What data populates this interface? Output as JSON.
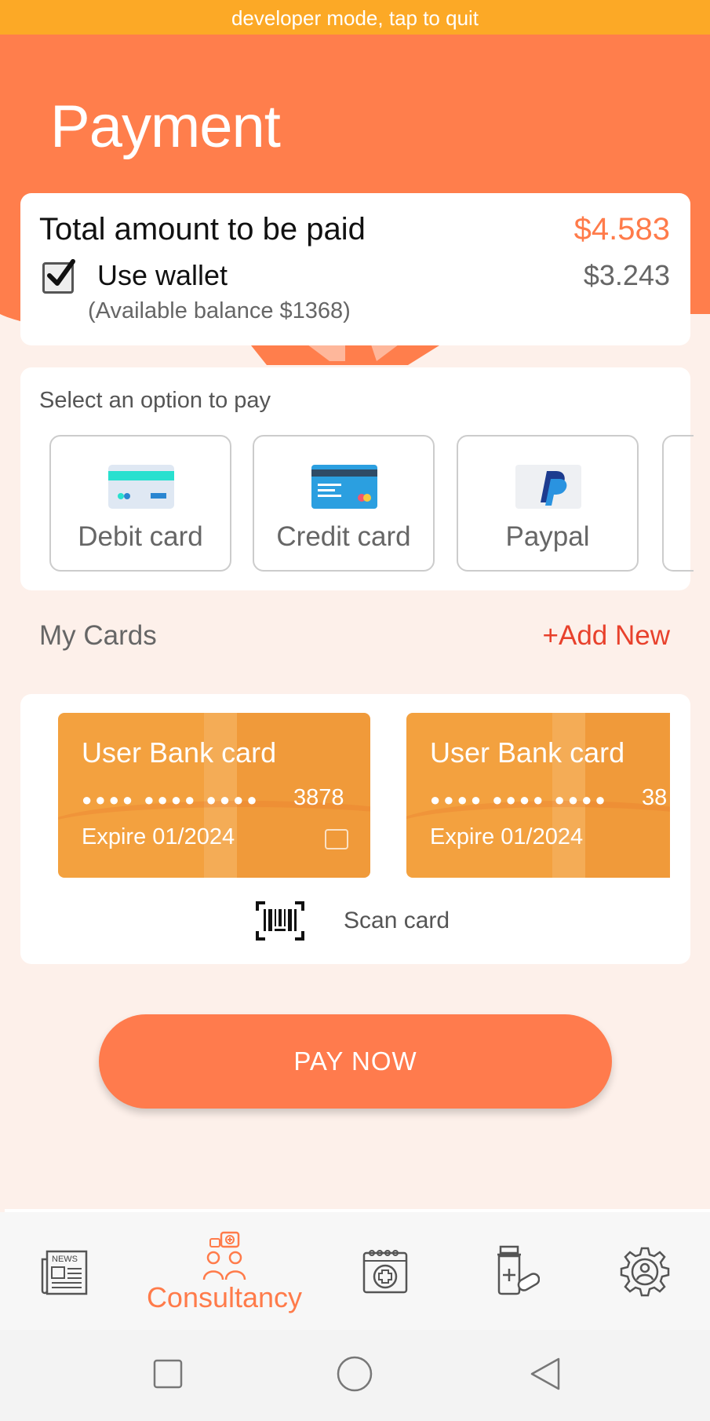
{
  "dev_banner": "developer mode, tap to quit",
  "page_title": "Payment",
  "summary": {
    "total_label": "Total amount to be paid",
    "total_value": "$4.583",
    "wallet_label": "Use wallet",
    "wallet_value": "$3.243",
    "wallet_checked": true,
    "available_balance": "(Available balance $1368)"
  },
  "payment_options": {
    "title": "Select an option to pay",
    "items": [
      {
        "label": "Debit card",
        "icon": "debit-card-icon"
      },
      {
        "label": "Credit card",
        "icon": "credit-card-icon"
      },
      {
        "label": "Paypal",
        "icon": "paypal-icon"
      }
    ]
  },
  "my_cards": {
    "title": "My Cards",
    "add_new": "+Add New",
    "cards": [
      {
        "title": "User Bank card",
        "dots": "●●●● ●●●● ●●●●",
        "last4": "3878",
        "expiry": "Expire 01/2024"
      },
      {
        "title": "User Bank card",
        "dots": "●●●● ●●●● ●●●●",
        "last4": "38",
        "expiry": "Expire 01/2024"
      }
    ],
    "scan_label": "Scan card"
  },
  "pay_button": "PAY NOW",
  "tabs": [
    {
      "icon": "news-icon",
      "label": ""
    },
    {
      "icon": "consultancy-icon",
      "label": "Consultancy",
      "active": true
    },
    {
      "icon": "calendar-medical-icon",
      "label": ""
    },
    {
      "icon": "medicine-icon",
      "label": ""
    },
    {
      "icon": "settings-gear-icon",
      "label": ""
    }
  ],
  "colors": {
    "accent": "#ff7e4c",
    "dev_banner": "#fca926",
    "card": "#f3a13f",
    "add_new": "#e8412c",
    "background": "#fdf0ea"
  }
}
